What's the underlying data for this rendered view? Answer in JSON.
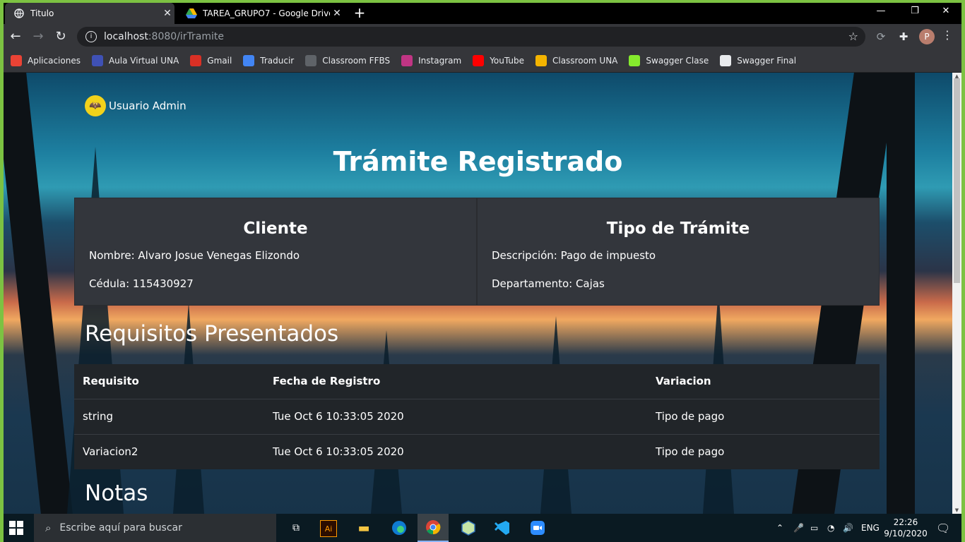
{
  "browser": {
    "tabs": [
      {
        "title": "Titulo",
        "active": true
      },
      {
        "title": "TAREA_GRUPO7 - Google Drive",
        "active": false
      }
    ],
    "url_host": "localhost",
    "url_rest": ":8080/irTramite",
    "profile_initial": "P",
    "bookmarks": [
      {
        "label": "Aplicaciones",
        "icon": "apps-grid-icon",
        "color": "#ea4335"
      },
      {
        "label": "Aula Virtual UNA",
        "icon": "aula-virtual-icon",
        "color": "#3f51b5"
      },
      {
        "label": "Gmail",
        "icon": "gmail-icon",
        "color": "#d93025"
      },
      {
        "label": "Traducir",
        "icon": "translate-icon",
        "color": "#4285f4"
      },
      {
        "label": "Classroom FFBS",
        "icon": "classroom-icon",
        "color": "#5f6368"
      },
      {
        "label": "Instagram",
        "icon": "instagram-icon",
        "color": "#c13584"
      },
      {
        "label": "YouTube",
        "icon": "youtube-icon",
        "color": "#ff0000"
      },
      {
        "label": "Classroom UNA",
        "icon": "classroom-icon",
        "color": "#f4b400"
      },
      {
        "label": "Swagger Clase",
        "icon": "swagger-icon",
        "color": "#85ea2d"
      },
      {
        "label": "Swagger Final",
        "icon": "globe-icon",
        "color": "#e8eaed"
      }
    ]
  },
  "page": {
    "user_name": "Usuario Admin",
    "title": "Trámite Registrado",
    "cliente": {
      "heading": "Cliente",
      "nombre": "Nombre: Alvaro Josue Venegas Elizondo",
      "cedula": "Cédula: 115430927"
    },
    "tipo": {
      "heading": "Tipo de Trámite",
      "descripcion": "Descripción: Pago de impuesto",
      "departamento": "Departamento: Cajas"
    },
    "requisitos_title": "Requisitos Presentados",
    "table": {
      "headers": [
        "Requisito",
        "Fecha de Registro",
        "Variacion"
      ],
      "rows": [
        [
          "string",
          "Tue Oct 6 10:33:05 2020",
          "Tipo de pago"
        ],
        [
          "Variacion2",
          "Tue Oct 6 10:33:05 2020",
          "Tipo de pago"
        ]
      ]
    },
    "notas_title": "Notas"
  },
  "taskbar": {
    "search_placeholder": "Escribe aquí para buscar",
    "language": "ENG",
    "time": "22:26",
    "date": "9/10/2020"
  }
}
